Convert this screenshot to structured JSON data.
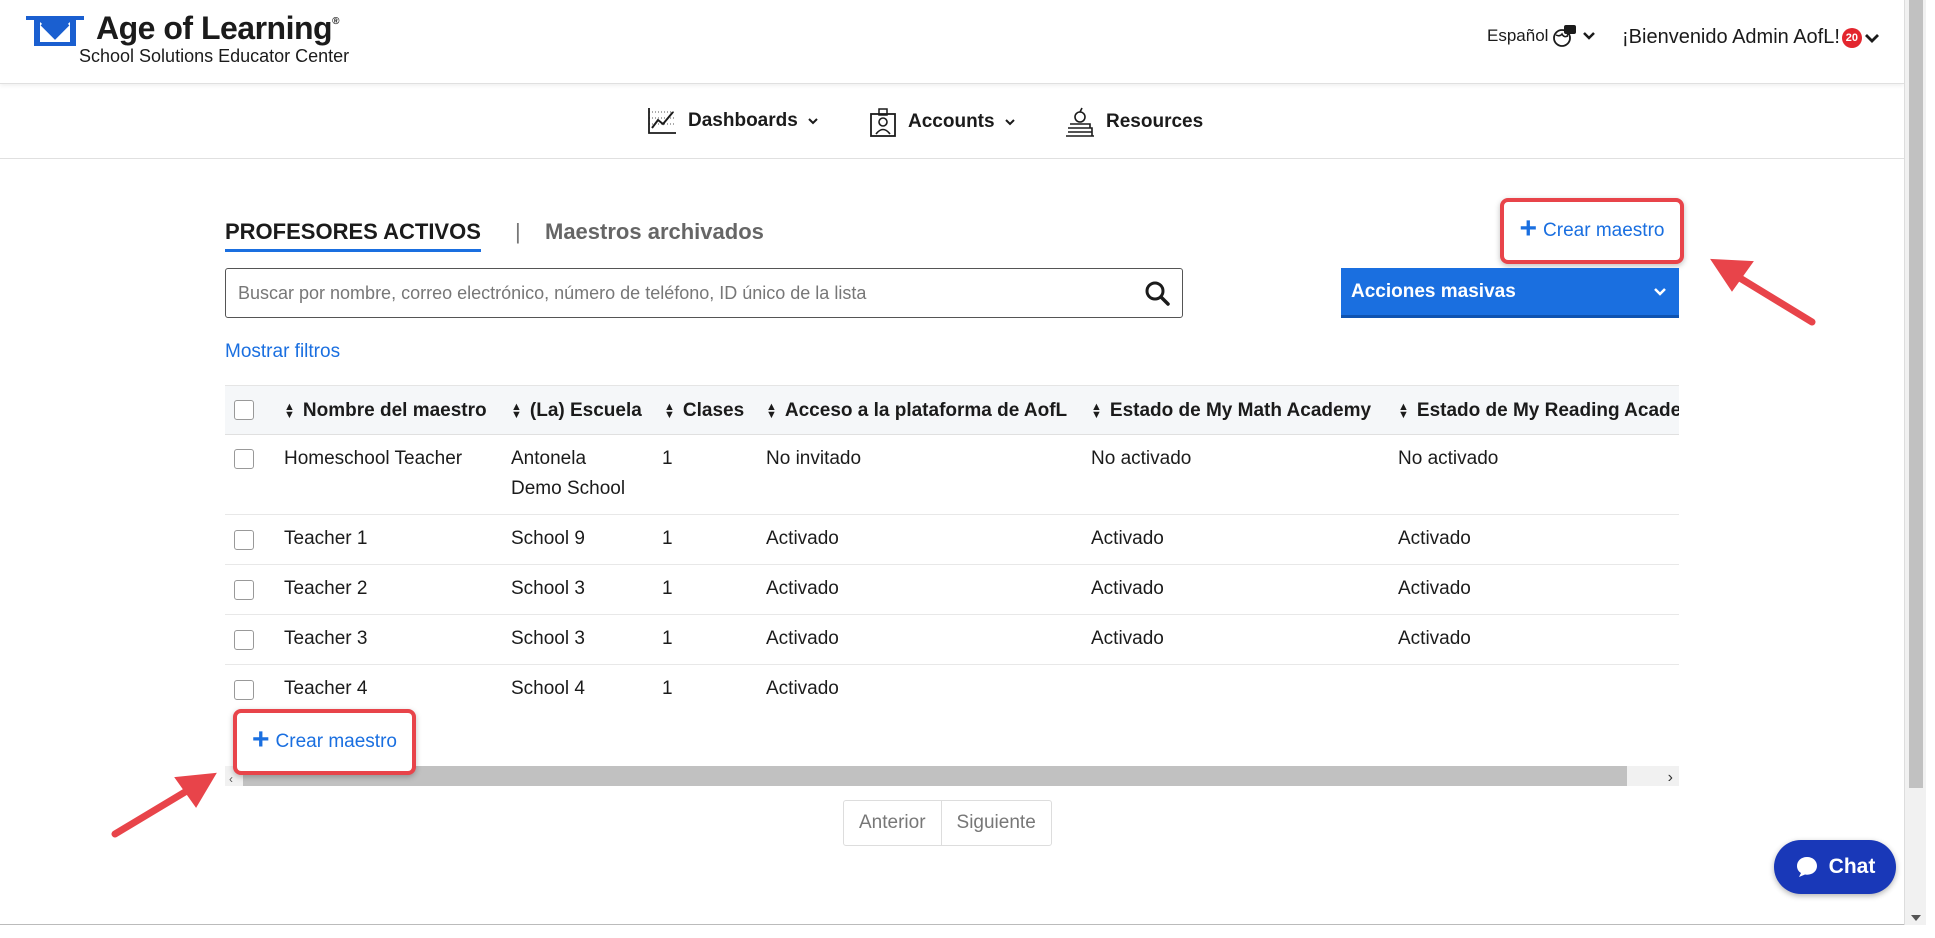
{
  "header": {
    "brand_title": "Age of Learning",
    "brand_reg": "®",
    "brand_subtitle": "School Solutions Educator Center",
    "language": "Español",
    "welcome": "¡Bienvenido Admin AofL!",
    "notification_count": "20"
  },
  "nav": {
    "items": [
      {
        "label": "Dashboards",
        "icon": "chart-icon"
      },
      {
        "label": "Accounts",
        "icon": "accounts-icon"
      },
      {
        "label": "Resources",
        "icon": "books-icon"
      }
    ]
  },
  "tabs": {
    "active": "PROFESORES ACTIVOS",
    "separator": "|",
    "archived": "Maestros archivados"
  },
  "actions": {
    "create_label": "Crear maestro",
    "bulk_label": "Acciones masivas",
    "show_filters": "Mostrar filtros"
  },
  "search": {
    "placeholder": "Buscar por nombre, correo electrónico, número de teléfono, ID único de la lista"
  },
  "table": {
    "columns": [
      "Nombre del maestro",
      "(La) Escuela",
      "Clases",
      "Acceso a la plataforma de AofL",
      "Estado de My Math Academy",
      "Estado de My Reading Academy"
    ],
    "rows": [
      {
        "name": "Homeschool Teacher",
        "school_line1": "Antonela",
        "school_line2": "Demo School",
        "classes": "1",
        "access": "No invitado",
        "math": "No activado",
        "reading": "No activado"
      },
      {
        "name": "Teacher 1",
        "school_line1": "School 9",
        "school_line2": "",
        "classes": "1",
        "access": "Activado",
        "math": "Activado",
        "reading": "Activado"
      },
      {
        "name": "Teacher 2",
        "school_line1": "School 3",
        "school_line2": "",
        "classes": "1",
        "access": "Activado",
        "math": "Activado",
        "reading": "Activado"
      },
      {
        "name": "Teacher 3",
        "school_line1": "School 3",
        "school_line2": "",
        "classes": "1",
        "access": "Activado",
        "math": "Activado",
        "reading": "Activado"
      },
      {
        "name": "Teacher 4",
        "school_line1": "School 4",
        "school_line2": "",
        "classes": "1",
        "access": "Activado",
        "math": "",
        "reading": ""
      }
    ]
  },
  "pager": {
    "prev": "Anterior",
    "next": "Siguiente"
  },
  "chat": {
    "label": "Chat"
  },
  "colors": {
    "accent": "#1a6fe0",
    "highlight": "#e8444a",
    "chat": "#1938b8"
  }
}
